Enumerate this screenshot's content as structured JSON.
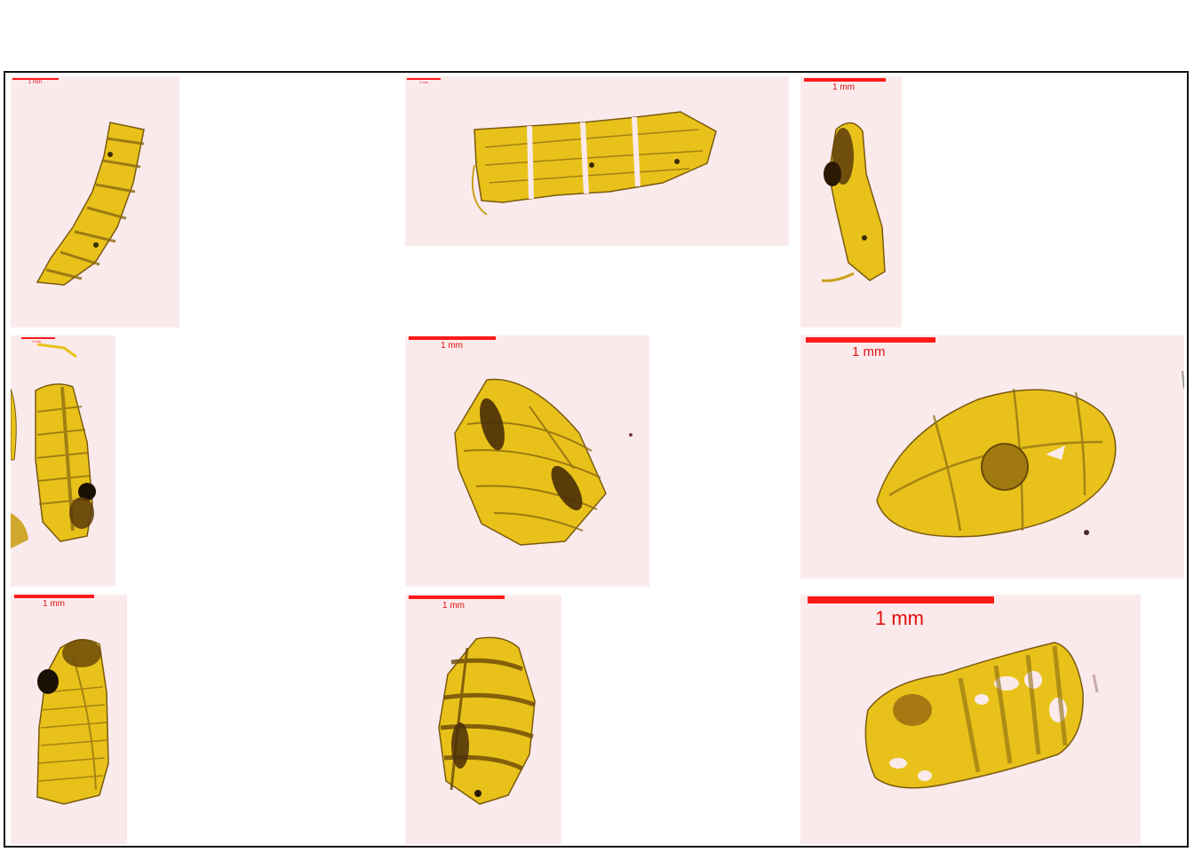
{
  "scale_label": "1 mm",
  "colors": {
    "tile_bg": "#fbeaec",
    "scale_red": "#ff1a1a",
    "specimen_fill": "#e8c21a",
    "specimen_edge": "#7a5a10",
    "frame": "#111111"
  },
  "panels": [
    {
      "name": "panel-1",
      "scale_label": "1 mm"
    },
    {
      "name": "panel-2",
      "scale_label": "1 mm"
    },
    {
      "name": "panel-3",
      "scale_label": "1 mm"
    },
    {
      "name": "panel-4",
      "scale_label": "1 mm"
    },
    {
      "name": "panel-5",
      "scale_label": "1 mm"
    },
    {
      "name": "panel-6",
      "scale_label": "1 mm"
    },
    {
      "name": "panel-7",
      "scale_label": "1 mm"
    },
    {
      "name": "panel-8",
      "scale_label": "1 mm"
    },
    {
      "name": "panel-9",
      "scale_label": "1 mm"
    }
  ]
}
